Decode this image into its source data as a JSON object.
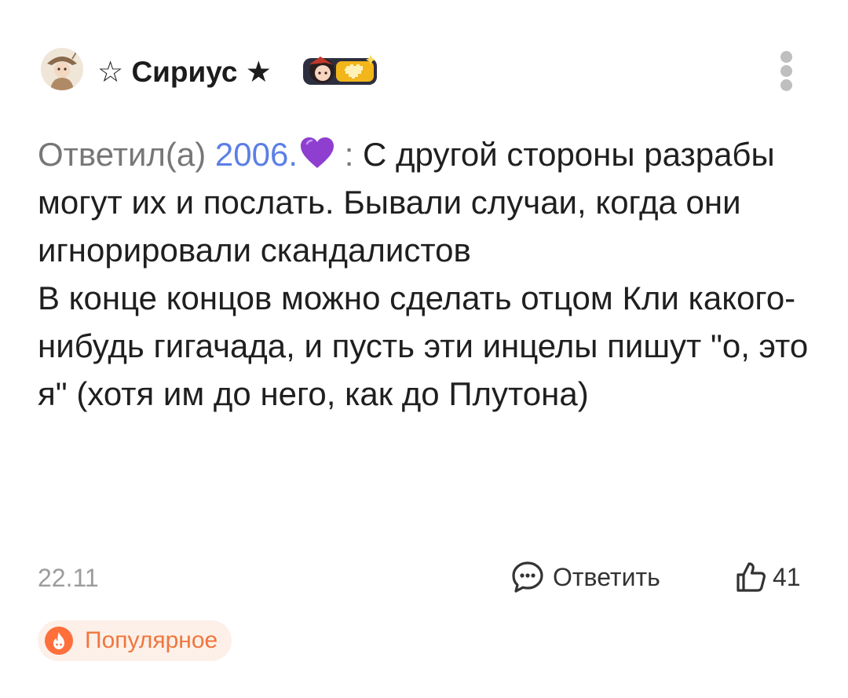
{
  "comment": {
    "author": {
      "name": "☆ Сириус ★",
      "avatar_icon": "avatar-image",
      "badge_icon": "character-badge-icon"
    },
    "menu_icon": "more-vertical-icon",
    "reply_prefix": "Ответил(а)",
    "mention": "2006.",
    "mention_emoji": "purple-heart-icon",
    "separator": " : ",
    "text_lines": [
      "С другой стороны разрабы могут их и послать. Бывали случаи, когда они игнорировали скандалистов",
      "В конце концов можно сделать отцом Кли какого-нибудь гигачада, и пусть эти инцелы пишут \"о, это я\" (хотя им до него, как до Плутона)"
    ],
    "date": "22.11",
    "reply_label": "Ответить",
    "reply_icon": "chat-bubble-icon",
    "like_icon": "thumbs-up-icon",
    "like_count": "41",
    "tag": {
      "label": "Популярное",
      "icon": "flame-icon"
    }
  },
  "colors": {
    "mention": "#5b7fe6",
    "secondary_text": "#777777",
    "tag_text": "#f0763c",
    "tag_background": "#fdf0e9",
    "heart": "#8e3fd0"
  }
}
